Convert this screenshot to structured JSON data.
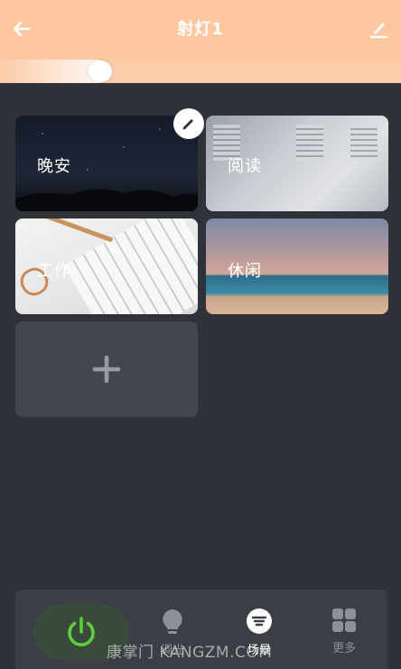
{
  "header": {
    "title": "射灯1",
    "back_icon": "arrow-left-icon",
    "edit_icon": "pencil-icon",
    "background": "#fdc7a0"
  },
  "brightness": {
    "level": 0.25
  },
  "scenes": [
    {
      "label": "晚安",
      "image": "night-sky"
    },
    {
      "label": "阅读",
      "image": "library"
    },
    {
      "label": "工作",
      "image": "desk-keyboard"
    },
    {
      "label": "休闲",
      "image": "beach-sunset"
    }
  ],
  "add_scene": {
    "icon": "plus-icon"
  },
  "bottom_nav": {
    "power_icon": "power-icon",
    "power_color": "#5fce3c",
    "items": [
      {
        "label": "调光",
        "icon": "bulb-icon"
      },
      {
        "label": "场景",
        "icon": "scene-icon",
        "active": true
      },
      {
        "label": "更多",
        "icon": "grid-icon"
      }
    ]
  },
  "watermark": "康掌门 KANGZM.COM"
}
